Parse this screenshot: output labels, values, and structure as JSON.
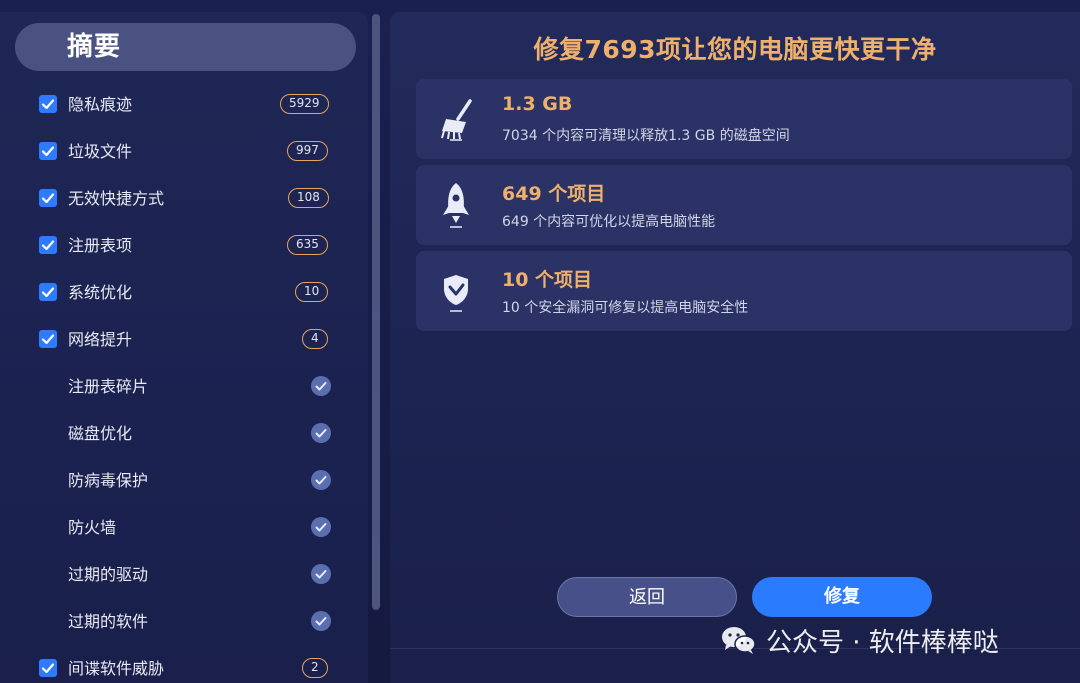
{
  "sidebar": {
    "summary_label": "摘要",
    "items": [
      {
        "label": "隐私痕迹",
        "checked": true,
        "count": "5929"
      },
      {
        "label": "垃圾文件",
        "checked": true,
        "count": "997"
      },
      {
        "label": "无效快捷方式",
        "checked": true,
        "count": "108"
      },
      {
        "label": "注册表项",
        "checked": true,
        "count": "635"
      },
      {
        "label": "系统优化",
        "checked": true,
        "count": "10"
      },
      {
        "label": "网络提升",
        "checked": true,
        "count": "4"
      },
      {
        "label": "注册表碎片",
        "status_icon": "check-circle-icon"
      },
      {
        "label": "磁盘优化",
        "status_icon": "check-circle-icon"
      },
      {
        "label": "防病毒保护",
        "status_icon": "check-circle-icon"
      },
      {
        "label": "防火墙",
        "status_icon": "check-circle-icon"
      },
      {
        "label": "过期的驱动",
        "status_icon": "check-circle-icon"
      },
      {
        "label": "过期的软件",
        "status_icon": "check-circle-icon"
      },
      {
        "label": "间谍软件威胁",
        "checked": true,
        "count": "2"
      }
    ]
  },
  "main": {
    "headline": "修复7693项让您的电脑更快更干净",
    "cards": [
      {
        "icon": "broom-icon",
        "title": "1.3 GB",
        "desc": "7034 个内容可清理以释放1.3 GB 的磁盘空间"
      },
      {
        "icon": "rocket-icon",
        "title": "649 个项目",
        "desc": "649 个内容可优化以提高电脑性能"
      },
      {
        "icon": "shield-icon",
        "title": "10 个项目",
        "desc": "10 个安全漏洞可修复以提高电脑安全性"
      }
    ],
    "back_label": "返回",
    "fix_label": "修复"
  },
  "watermark": {
    "text": "公众号 · 软件棒棒哒",
    "icon": "wechat-icon"
  },
  "colors": {
    "accent_orange": "#efb06b",
    "accent_blue": "#2b7bff",
    "background": "#1a2050"
  }
}
